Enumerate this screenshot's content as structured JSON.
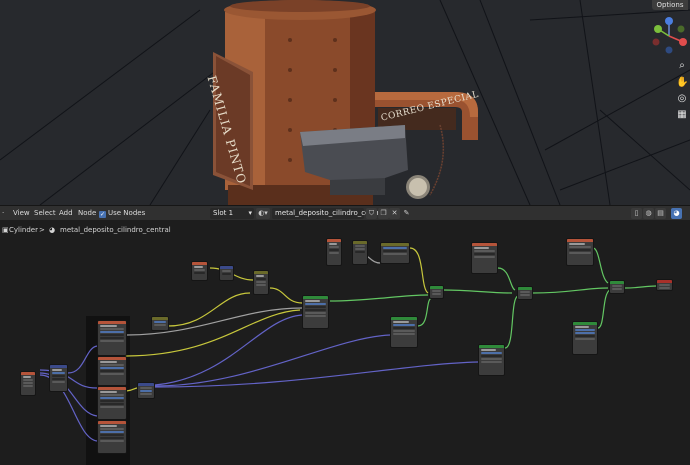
{
  "viewport": {
    "options_label": "Options",
    "sign_text": "FAMILIA PINTO",
    "pipe_text": "CORREO ESPECIAL",
    "gizmo_icon": "axis-gizmo-icon",
    "tools": [
      "zoom-icon",
      "hand-icon",
      "camera-icon",
      "grid-icon"
    ]
  },
  "header": {
    "menus": [
      "View",
      "Select",
      "Add",
      "Node"
    ],
    "use_nodes_label": "Use Nodes",
    "use_nodes_checked": true,
    "slot_value": "Slot 1",
    "material_name": "metal_deposito_cilindro_central"
  },
  "breadcrumb": {
    "object": "Cylinder",
    "separator": ">",
    "material": "metal_deposito_cilindro_central"
  },
  "colors": {
    "wire_yellow": "#c7c73c",
    "wire_gray": "#a1a1a1",
    "wire_green": "#63c763",
    "wire_purple": "#6363c7",
    "header_texture": "#b5543a",
    "header_shader": "#2f8a3a",
    "header_vector": "#3b4a8a",
    "header_output": "#a8302a"
  }
}
